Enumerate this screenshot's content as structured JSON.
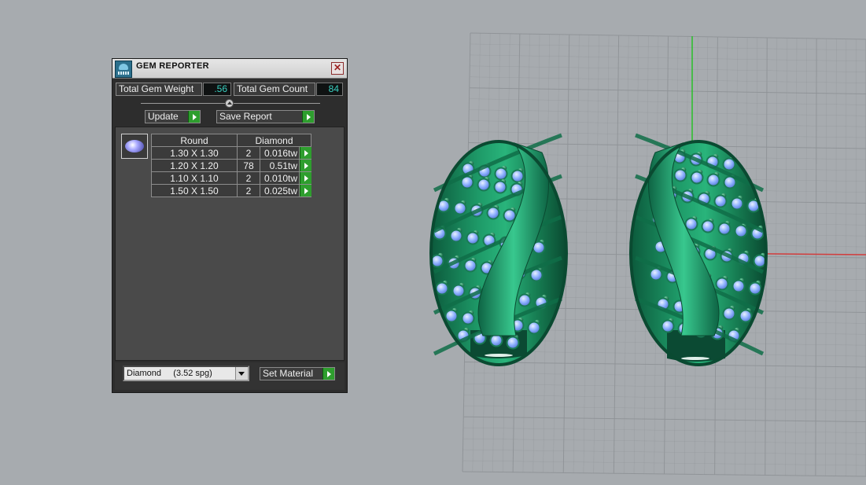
{
  "panel": {
    "title": "GEM REPORTER",
    "total_weight_label": "Total Gem Weight",
    "total_weight_value": ".56",
    "total_count_label": "Total Gem Count",
    "total_count_value": "84",
    "update_label": "Update",
    "save_label": "Save Report",
    "gem_shape": "Round",
    "gem_material": "Diamond",
    "rows": [
      {
        "size": "1.30 X 1.30",
        "count": "2",
        "weight": "0.016tw"
      },
      {
        "size": "1.20 X 1.20",
        "count": "78",
        "weight": "0.51tw"
      },
      {
        "size": "1.10 X 1.10",
        "count": "2",
        "weight": "0.010tw"
      },
      {
        "size": "1.50 X 1.50",
        "count": "2",
        "weight": "0.025tw"
      }
    ],
    "material_select": "Diamond     (3.52 spg)",
    "set_material_label": "Set Material"
  },
  "colors": {
    "viewport_bg": "#a7abaf",
    "grid_line": "#8e9296",
    "axis_green": "#28c028",
    "axis_red": "#d23c3c",
    "ring_metal": "#1f8f62",
    "gem_blue": "#8fb2ff"
  }
}
